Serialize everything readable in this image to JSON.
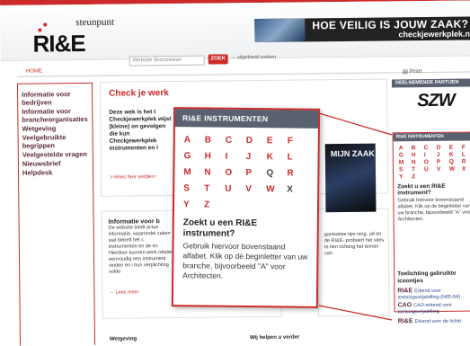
{
  "header": {
    "logo_small": "steunpunt",
    "logo_main": "RI&E",
    "banner_line1": "HOE VEILIG IS JOUW ZAAK?",
    "banner_line2": "checkjewerkplek.nl",
    "search_placeholder": "Website doorzoeken",
    "search_button": "ZOEK",
    "advanced_search": "→ uitgebreid zoeken"
  },
  "nav": {
    "home": "HOME"
  },
  "sidebar": {
    "items": [
      {
        "label": "Informatie voor bedrijven"
      },
      {
        "label": "Informatie voor brancheorganisaties"
      },
      {
        "label": "Wetgeving"
      },
      {
        "label": "Veelgebruikte begrippen"
      },
      {
        "label": "Veelgestelde vragen"
      },
      {
        "label": "Nieuwsbrief"
      },
      {
        "label": "Helpdesk"
      }
    ]
  },
  "main": {
    "check_title": "Check je werk",
    "check_body": "Deze wek is het t Checkjewerkplek wijst (kleine) on gevolgen die kun Checkjewerkplek instrumenten en l",
    "check_link": ">>lees hier verder<",
    "info_title": "Informatie voor b",
    "info_body": "De website biedt actue informatie, waarondel zaken wat betreft het c instrumenten en de en Hierdoor kunnen werk relatief eenvoudig een instrument vinden en i hun verplichting voldo",
    "info_link": "→ Lees meer",
    "right_mid_text": "ganisaties tips ning, ud en de RI&E- probeert het sties te tien richting het terrein van",
    "mijnzaak_title": "MIJN ZAAK",
    "bottom_left": "Wetgeving",
    "bottom_right": "Wij helpen u verder"
  },
  "right": {
    "print": "Print",
    "partners_header": "DEELNEMENDE PARTIJEN",
    "szw": "SZW",
    "mini_header": "RI&E INSTRUMENTEN",
    "mini_letters": [
      "A",
      "B",
      "C",
      "D",
      "E",
      "F",
      "G",
      "H",
      "I",
      "J",
      "K",
      "L",
      "M",
      "N",
      "O",
      "P",
      "Q",
      "R",
      "S",
      "T",
      "U",
      "V",
      "W",
      "X",
      "Y",
      "Z"
    ],
    "mini_question": "Zoekt u een RI&E instrument?",
    "mini_help": "Gebruik hiervoor bovenstaand alfabet. Klik op de beginletter van uw branche, bijvoorbeeld \"A\" voor Architecten.",
    "toelichting": "Toelichting gebruikte icoontjes",
    "icon_items": [
      {
        "badge": "RI&E",
        "text": "Erkend voor toetsingsvrijstelling (NIEUW)"
      },
      {
        "badge": "CAO",
        "text": "CAO-erkend voor toetsingsvrijstelling"
      },
      {
        "badge": "RI&E",
        "text": "Erkend voor de lichte"
      }
    ]
  },
  "popup": {
    "header": "RI&E INSTRUMENTEN",
    "letters": [
      "A",
      "B",
      "C",
      "D",
      "E",
      "F",
      "G",
      "H",
      "I",
      "J",
      "K",
      "L",
      "M",
      "N",
      "O",
      "P",
      "Q",
      "R",
      "S",
      "T",
      "U",
      "V",
      "W",
      "X",
      "Y",
      "Z"
    ],
    "question": "Zoekt u een RI&E instrument?",
    "help": "Gebruik hiervoor bovenstaand alfabet. Klik op de beginletter van uw branche, bijvoorbeeld \"A\" voor Architecten."
  },
  "colors": {
    "accent": "#cc2a2a",
    "header_bar": "#5a6170"
  }
}
